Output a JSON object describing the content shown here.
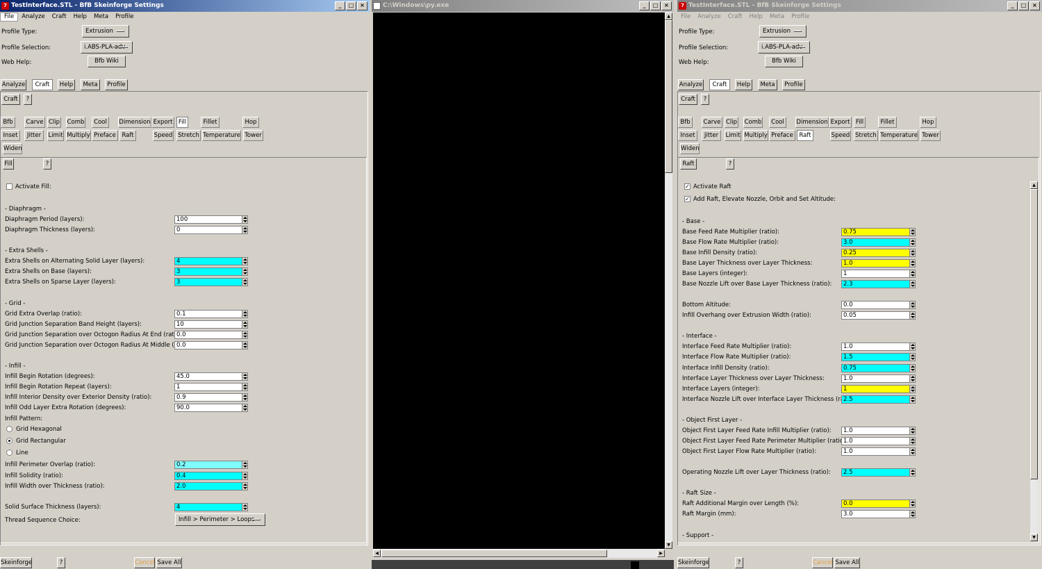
{
  "left": {
    "title": "TestInterface.STL - BfB Skeinforge Settings",
    "menu": [
      "File",
      "Analyze",
      "Craft",
      "Help",
      "Meta",
      "Profile"
    ],
    "profile_type_label": "Profile Type:",
    "profile_type_value": "Extrusion",
    "profile_selection_label": "Profile Selection:",
    "profile_selection_value": "i.ABS-PLA-adv",
    "web_help_label": "Web Help:",
    "web_help_button": "Bfb Wiki",
    "top_tabs": [
      "Analyze",
      "Craft",
      "Help",
      "Meta",
      "Profile"
    ],
    "craft_button": "Craft",
    "help_q": "?",
    "plugins_row1": [
      "Bfb",
      "Carve",
      "Clip",
      "Comb",
      "Cool",
      "Dimension",
      "Export",
      "Fill",
      "Fillet",
      "Hop"
    ],
    "plugins_row2": [
      "Inset",
      "Jitter",
      "Limit",
      "Multiply",
      "Preface",
      "Raft",
      "Speed",
      "Stretch",
      "Temperature",
      "Tower"
    ],
    "plugins_row3": [
      "Widen"
    ],
    "plugin_title": "Fill",
    "activate": "Activate Fill:",
    "rows": [
      {
        "t": "h",
        "label": "- Diaphragm -"
      },
      {
        "t": "f",
        "label": "Diaphragm Period (layers):",
        "value": "100"
      },
      {
        "t": "f",
        "label": "Diaphragm Thickness (layers):",
        "value": "0"
      },
      {
        "t": "h",
        "label": "- Extra Shells -"
      },
      {
        "t": "f",
        "label": "Extra Shells on Alternating Solid Layer (layers):",
        "value": "4",
        "c": "cyan"
      },
      {
        "t": "f",
        "label": "Extra Shells on Base (layers):",
        "value": "3",
        "c": "cyan"
      },
      {
        "t": "f",
        "label": "Extra Shells on Sparse Layer (layers):",
        "value": "3",
        "c": "cyan"
      },
      {
        "t": "h",
        "label": "- Grid -"
      },
      {
        "t": "f",
        "label": "Grid Extra Overlap (ratio):",
        "value": "0.1"
      },
      {
        "t": "f",
        "label": "Grid Junction Separation Band Height (layers):",
        "value": "10"
      },
      {
        "t": "f",
        "label": "Grid Junction Separation over Octogon Radius At End (ratio):",
        "value": "0.0"
      },
      {
        "t": "f",
        "label": "Grid Junction Separation over Octogon Radius At Middle (ratio):",
        "value": "0.0"
      },
      {
        "t": "h",
        "label": "- Infill -"
      },
      {
        "t": "f",
        "label": "Infill Begin Rotation (degrees):",
        "value": "45.0"
      },
      {
        "t": "f",
        "label": "Infill Begin Rotation Repeat (layers):",
        "value": "1"
      },
      {
        "t": "f",
        "label": "Infill Interior Density over Exterior Density (ratio):",
        "value": "0.9"
      },
      {
        "t": "f",
        "label": "Infill Odd Layer Extra Rotation (degrees):",
        "value": "90.0"
      },
      {
        "t": "l",
        "label": "Infill Pattern:"
      },
      {
        "t": "r",
        "label": "Grid Hexagonal",
        "on": false
      },
      {
        "t": "r",
        "label": "Grid Rectangular",
        "on": true
      },
      {
        "t": "r",
        "label": "Line",
        "on": false
      },
      {
        "t": "f",
        "label": "Infill Perimeter Overlap (ratio):",
        "value": "0.2",
        "c": "lcyan"
      },
      {
        "t": "f",
        "label": "Infill Solidity (ratio):",
        "value": "0.4",
        "c": "cyan"
      },
      {
        "t": "f",
        "label": "Infill Width over Thickness (ratio):",
        "value": "2.0",
        "c": "cyan"
      },
      {
        "t": "f",
        "label": "Solid Surface Thickness (layers):",
        "value": "4",
        "c": "cyan"
      },
      {
        "t": "d",
        "label": "Thread Sequence Choice:",
        "value": "Infill > Perimeter > Loops"
      }
    ],
    "skeinforge": "Skeinforge",
    "cancel": "Cancel",
    "save_all": "Save All"
  },
  "center": {
    "title": "C:\\Windows\\py.exe"
  },
  "right": {
    "title": "TestInterface.STL - BfB Skeinforge Settings",
    "menu": [
      "File",
      "Analyze",
      "Craft",
      "Help",
      "Meta",
      "Profile"
    ],
    "profile_type_label": "Profile Type:",
    "profile_type_value": "Extrusion",
    "profile_selection_label": "Profile Selection:",
    "profile_selection_value": "i.ABS-PLA-adv",
    "web_help_label": "Web Help:",
    "web_help_button": "Bfb Wiki",
    "top_tabs": [
      "Analyze",
      "Craft",
      "Help",
      "Meta",
      "Profile"
    ],
    "craft_button": "Craft",
    "help_q": "?",
    "plugins_row1": [
      "Bfb",
      "Carve",
      "Clip",
      "Comb",
      "Cool",
      "Dimension",
      "Export",
      "Fill",
      "Fillet",
      "Hop"
    ],
    "plugins_row2": [
      "Inset",
      "Jitter",
      "Limit",
      "Multiply",
      "Preface",
      "Raft",
      "Speed",
      "Stretch",
      "Temperature",
      "Tower"
    ],
    "plugins_row3": [
      "Widen"
    ],
    "plugin_title": "Raft",
    "rows": [
      {
        "t": "c",
        "label": "Activate Raft",
        "on": true
      },
      {
        "t": "c",
        "label": "Add Raft, Elevate Nozzle, Orbit and Set Altitude:",
        "on": true
      },
      {
        "t": "h",
        "label": "- Base -"
      },
      {
        "t": "f",
        "label": "Base Feed Rate Multiplier (ratio):",
        "value": "0.75",
        "c": "yellow"
      },
      {
        "t": "f",
        "label": "Base Flow Rate Multiplier (ratio):",
        "value": "3.0",
        "c": "cyan"
      },
      {
        "t": "f",
        "label": "Base Infill Density (ratio):",
        "value": "0.25",
        "c": "yellow"
      },
      {
        "t": "f",
        "label": "Base Layer Thickness over Layer Thickness:",
        "value": "1.0",
        "c": "yellow"
      },
      {
        "t": "f",
        "label": "Base Layers (integer):",
        "value": "1"
      },
      {
        "t": "f",
        "label": "Base Nozzle Lift over Base Layer Thickness (ratio):",
        "value": "2.3",
        "c": "cyan"
      },
      {
        "t": "f",
        "label": "Bottom Altitude:",
        "value": "0.0"
      },
      {
        "t": "f",
        "label": "Infill Overhang over Extrusion Width (ratio):",
        "value": "0.05"
      },
      {
        "t": "h",
        "label": "- Interface -"
      },
      {
        "t": "f",
        "label": "Interface Feed Rate Multiplier (ratio):",
        "value": "1.0"
      },
      {
        "t": "f",
        "label": "Interface Flow Rate Multiplier (ratio):",
        "value": "1.5",
        "c": "cyan"
      },
      {
        "t": "f",
        "label": "Interface Infill Density (ratio):",
        "value": "0.75",
        "c": "cyan"
      },
      {
        "t": "f",
        "label": "Interface Layer Thickness over Layer Thickness:",
        "value": "1.0"
      },
      {
        "t": "f",
        "label": "Interface Layers (integer):",
        "value": "1",
        "c": "yellow"
      },
      {
        "t": "f",
        "label": "Interface Nozzle Lift over Interface Layer Thickness (ratio):",
        "value": "2.5",
        "c": "cyan"
      },
      {
        "t": "h",
        "label": "- Object First Layer -"
      },
      {
        "t": "f",
        "label": "Object First Layer Feed Rate Infill Multiplier (ratio):",
        "value": "1.0"
      },
      {
        "t": "f",
        "label": "Object First Layer Feed Rate Perimeter Multiplier (ratio):",
        "value": "1.0"
      },
      {
        "t": "f",
        "label": "Object First Layer Flow Rate Multiplier (ratio):",
        "value": "1.0"
      },
      {
        "t": "f",
        "label": "Operating Nozzle Lift over Layer Thickness (ratio):",
        "value": "2.5",
        "c": "cyan"
      },
      {
        "t": "h",
        "label": "- Raft Size -"
      },
      {
        "t": "f",
        "label": "Raft Additional Margin over Length (%):",
        "value": "0.0",
        "c": "yellow"
      },
      {
        "t": "f",
        "label": "Raft Margin (mm):",
        "value": "3.0"
      },
      {
        "t": "h",
        "label": "- Support -"
      }
    ],
    "skeinforge": "Skeinforge",
    "cancel": "Cancel",
    "save_all": "Save All"
  }
}
